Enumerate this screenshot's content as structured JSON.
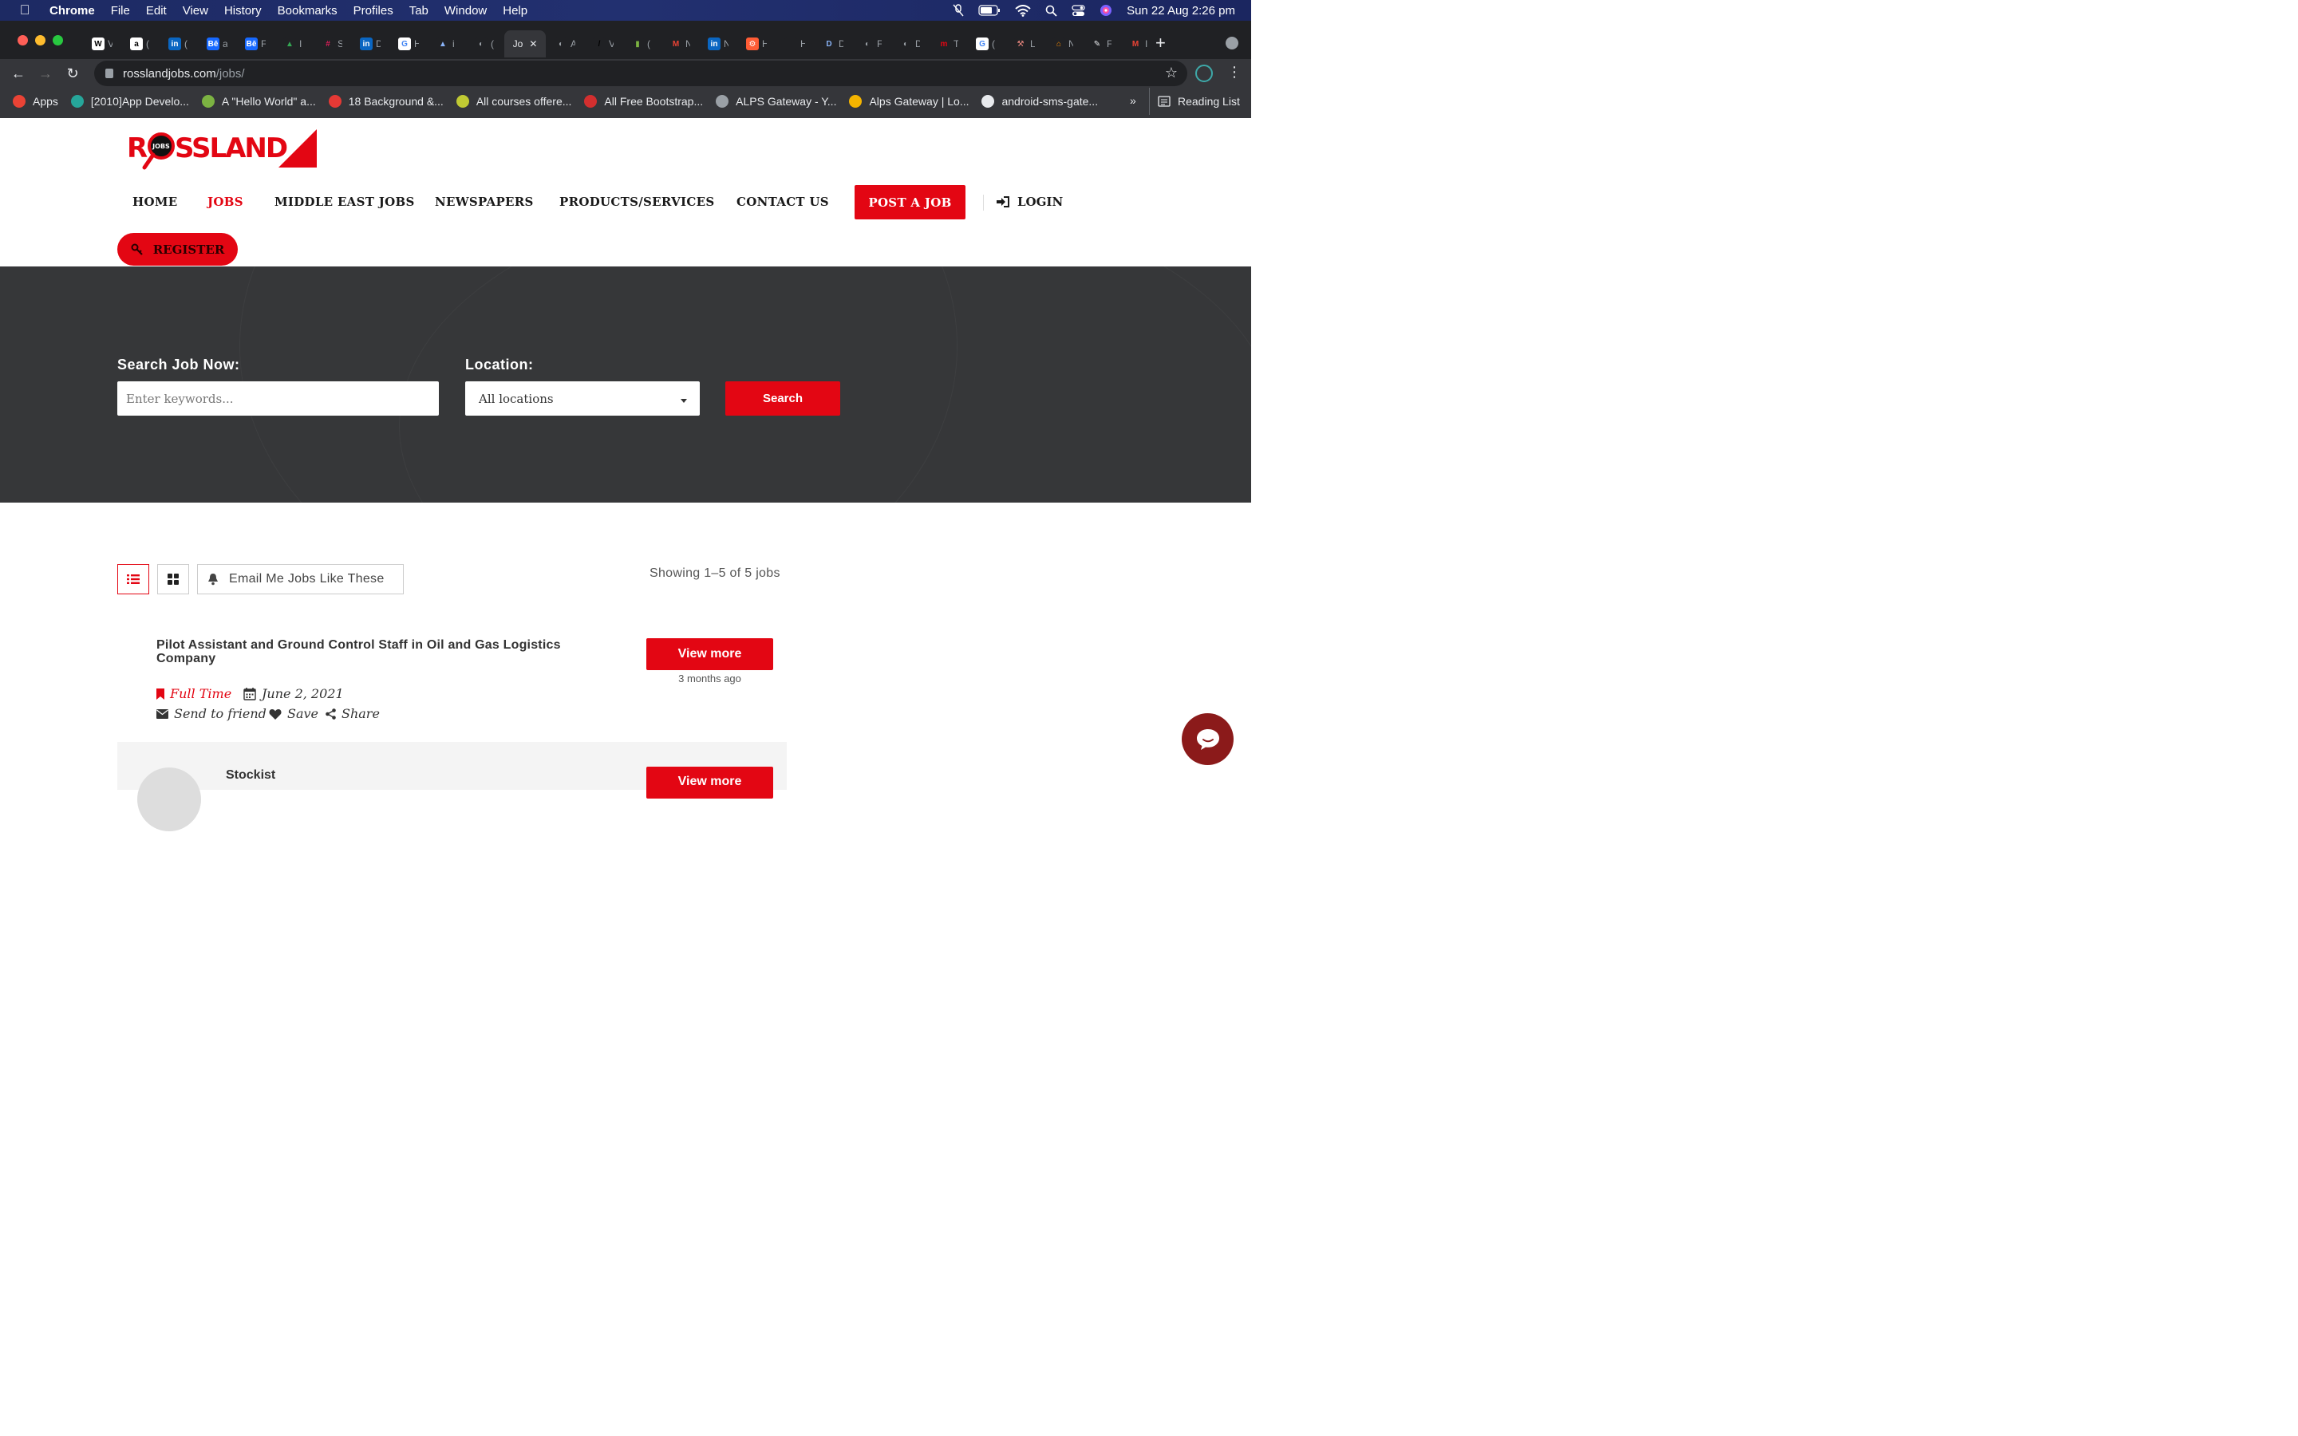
{
  "macos": {
    "app": "Chrome",
    "menu": [
      "File",
      "Edit",
      "View",
      "History",
      "Bookmarks",
      "Profiles",
      "Tab",
      "Window",
      "Help"
    ],
    "datetime": "Sun 22 Aug  2:26 pm"
  },
  "browser": {
    "active_tab_label": "Jo",
    "url_host": "rosslandjobs.com",
    "url_path": "/jobs/",
    "tabs": [
      {
        "icon": "wikipedia-icon",
        "glyph": "W",
        "color": "#ffffff",
        "fg": "#000000",
        "text": "V"
      },
      {
        "icon": "amazon-icon",
        "glyph": "a",
        "color": "#ffffff",
        "fg": "#000000",
        "text": "("
      },
      {
        "icon": "linkedin-icon",
        "glyph": "in",
        "color": "#0a66c2",
        "fg": "#ffffff",
        "text": "("
      },
      {
        "icon": "behance-icon",
        "glyph": "Bē",
        "color": "#1769ff",
        "fg": "#ffffff",
        "text": "a"
      },
      {
        "icon": "behance-icon",
        "glyph": "Bē",
        "color": "#1769ff",
        "fg": "#ffffff",
        "text": "F"
      },
      {
        "icon": "google-drive-icon",
        "glyph": "▲",
        "color": "#202124",
        "fg": "#34a853",
        "text": "I"
      },
      {
        "icon": "slack-icon",
        "glyph": "#",
        "color": "#202124",
        "fg": "#e01e5a",
        "text": "S"
      },
      {
        "icon": "linkedin-icon",
        "glyph": "in",
        "color": "#0a66c2",
        "fg": "#ffffff",
        "text": "D"
      },
      {
        "icon": "google-icon",
        "glyph": "G",
        "color": "#ffffff",
        "fg": "#4285f4",
        "text": "H"
      },
      {
        "icon": "triangle-icon",
        "glyph": "▲",
        "color": "#202124",
        "fg": "#8ab4f8",
        "text": "i"
      },
      {
        "icon": "globe-icon",
        "glyph": "◐",
        "color": "#202124",
        "fg": "#9aa0a6",
        "text": "("
      },
      {
        "icon": "globe-icon",
        "glyph": "◐",
        "color": "#202124",
        "fg": "#9aa0a6",
        "text": "A"
      },
      {
        "icon": "slash-icon",
        "glyph": "/",
        "color": "#202124",
        "fg": "#000000",
        "text": "V"
      },
      {
        "icon": "bars-icon",
        "glyph": "▮",
        "color": "#202124",
        "fg": "#7cb342",
        "text": "("
      },
      {
        "icon": "gmail-icon",
        "glyph": "M",
        "color": "#202124",
        "fg": "#ea4335",
        "text": "N"
      },
      {
        "icon": "linkedin-icon",
        "glyph": "in",
        "color": "#0a66c2",
        "fg": "#ffffff",
        "text": "N"
      },
      {
        "icon": "hubspot-icon",
        "glyph": "⚙",
        "color": "#ff5c35",
        "fg": "#ffffff",
        "text": "H"
      },
      {
        "icon": "blank-icon",
        "glyph": "",
        "color": "#202124",
        "fg": "#202124",
        "text": "H"
      },
      {
        "icon": "d-icon",
        "glyph": "D",
        "color": "#202124",
        "fg": "#8ab4f8",
        "text": "D"
      },
      {
        "icon": "globe-icon",
        "glyph": "◐",
        "color": "#202124",
        "fg": "#9aa0a6",
        "text": "F"
      },
      {
        "icon": "globe-icon",
        "glyph": "◐",
        "color": "#202124",
        "fg": "#9aa0a6",
        "text": "D"
      },
      {
        "icon": "m-icon",
        "glyph": "m",
        "color": "#202124",
        "fg": "#e30613",
        "text": "T"
      },
      {
        "icon": "google-icon",
        "glyph": "G",
        "color": "#ffffff",
        "fg": "#4285f4",
        "text": "("
      },
      {
        "icon": "hammer-icon",
        "glyph": "⚒",
        "color": "#202124",
        "fg": "#f28b82",
        "text": "L"
      },
      {
        "icon": "home-icon",
        "glyph": "⌂",
        "color": "#202124",
        "fg": "#fb8c00",
        "text": "N"
      },
      {
        "icon": "pen-icon",
        "glyph": "✎",
        "color": "#202124",
        "fg": "#e8eaed",
        "text": "F"
      },
      {
        "icon": "gmail-icon",
        "glyph": "M",
        "color": "#202124",
        "fg": "#ea4335",
        "text": "I"
      }
    ],
    "bookmarks": [
      {
        "icon": "apps-grid-icon",
        "label": "Apps",
        "color": "#ea4335"
      },
      {
        "icon": "s-circle-icon",
        "label": "[2010]App Develo...",
        "color": "#26a69a"
      },
      {
        "icon": "leaf-icon",
        "label": "A \"Hello World\" a...",
        "color": "#7cb342"
      },
      {
        "icon": "r-circle-icon",
        "label": "18 Background &...",
        "color": "#e53935"
      },
      {
        "icon": "course-icon",
        "label": "All courses offere...",
        "color": "#c0ca33"
      },
      {
        "icon": "s-square-icon",
        "label": "All Free Bootstrap...",
        "color": "#d32f2f"
      },
      {
        "icon": "globe-icon",
        "label": "ALPS Gateway - Y...",
        "color": "#9aa0a6"
      },
      {
        "icon": "pinwheel-icon",
        "label": "Alps Gateway | Lo...",
        "color": "#f4b400"
      },
      {
        "icon": "github-icon",
        "label": "android-sms-gate...",
        "color": "#e8eaed"
      }
    ],
    "overflow": "»",
    "reading_list": "Reading List"
  },
  "site": {
    "nav": [
      "HOME",
      "JOBS",
      "MIDDLE EAST JOBS",
      "NEWSPAPERS",
      "PRODUCTS/SERVICES",
      "CONTACT US"
    ],
    "post_job": "POST A JOB",
    "login": "LOGIN",
    "register": "REGISTER",
    "brand_color": "#e30613",
    "logo": {
      "left_text": "R",
      "badge": "JOBS",
      "right_text": "SSLAND"
    }
  },
  "search": {
    "keyword_label": "Search Job Now:",
    "keyword_placeholder": "Enter keywords...",
    "location_label": "Location:",
    "location_value": "All locations",
    "button": "Search"
  },
  "listing": {
    "email_alert": "Email Me Jobs Like These",
    "showing": "Showing 1–5 of 5 jobs",
    "jobs": [
      {
        "title": "Pilot Assistant and Ground Control Staff in Oil and Gas Logistics Company",
        "type": "Full Time",
        "date": "June 2, 2021",
        "ago": "3 months ago",
        "send": "Send to friend",
        "save": "Save",
        "share": "Share",
        "button": "View more"
      },
      {
        "title": "Stockist",
        "button": "View more"
      }
    ]
  }
}
